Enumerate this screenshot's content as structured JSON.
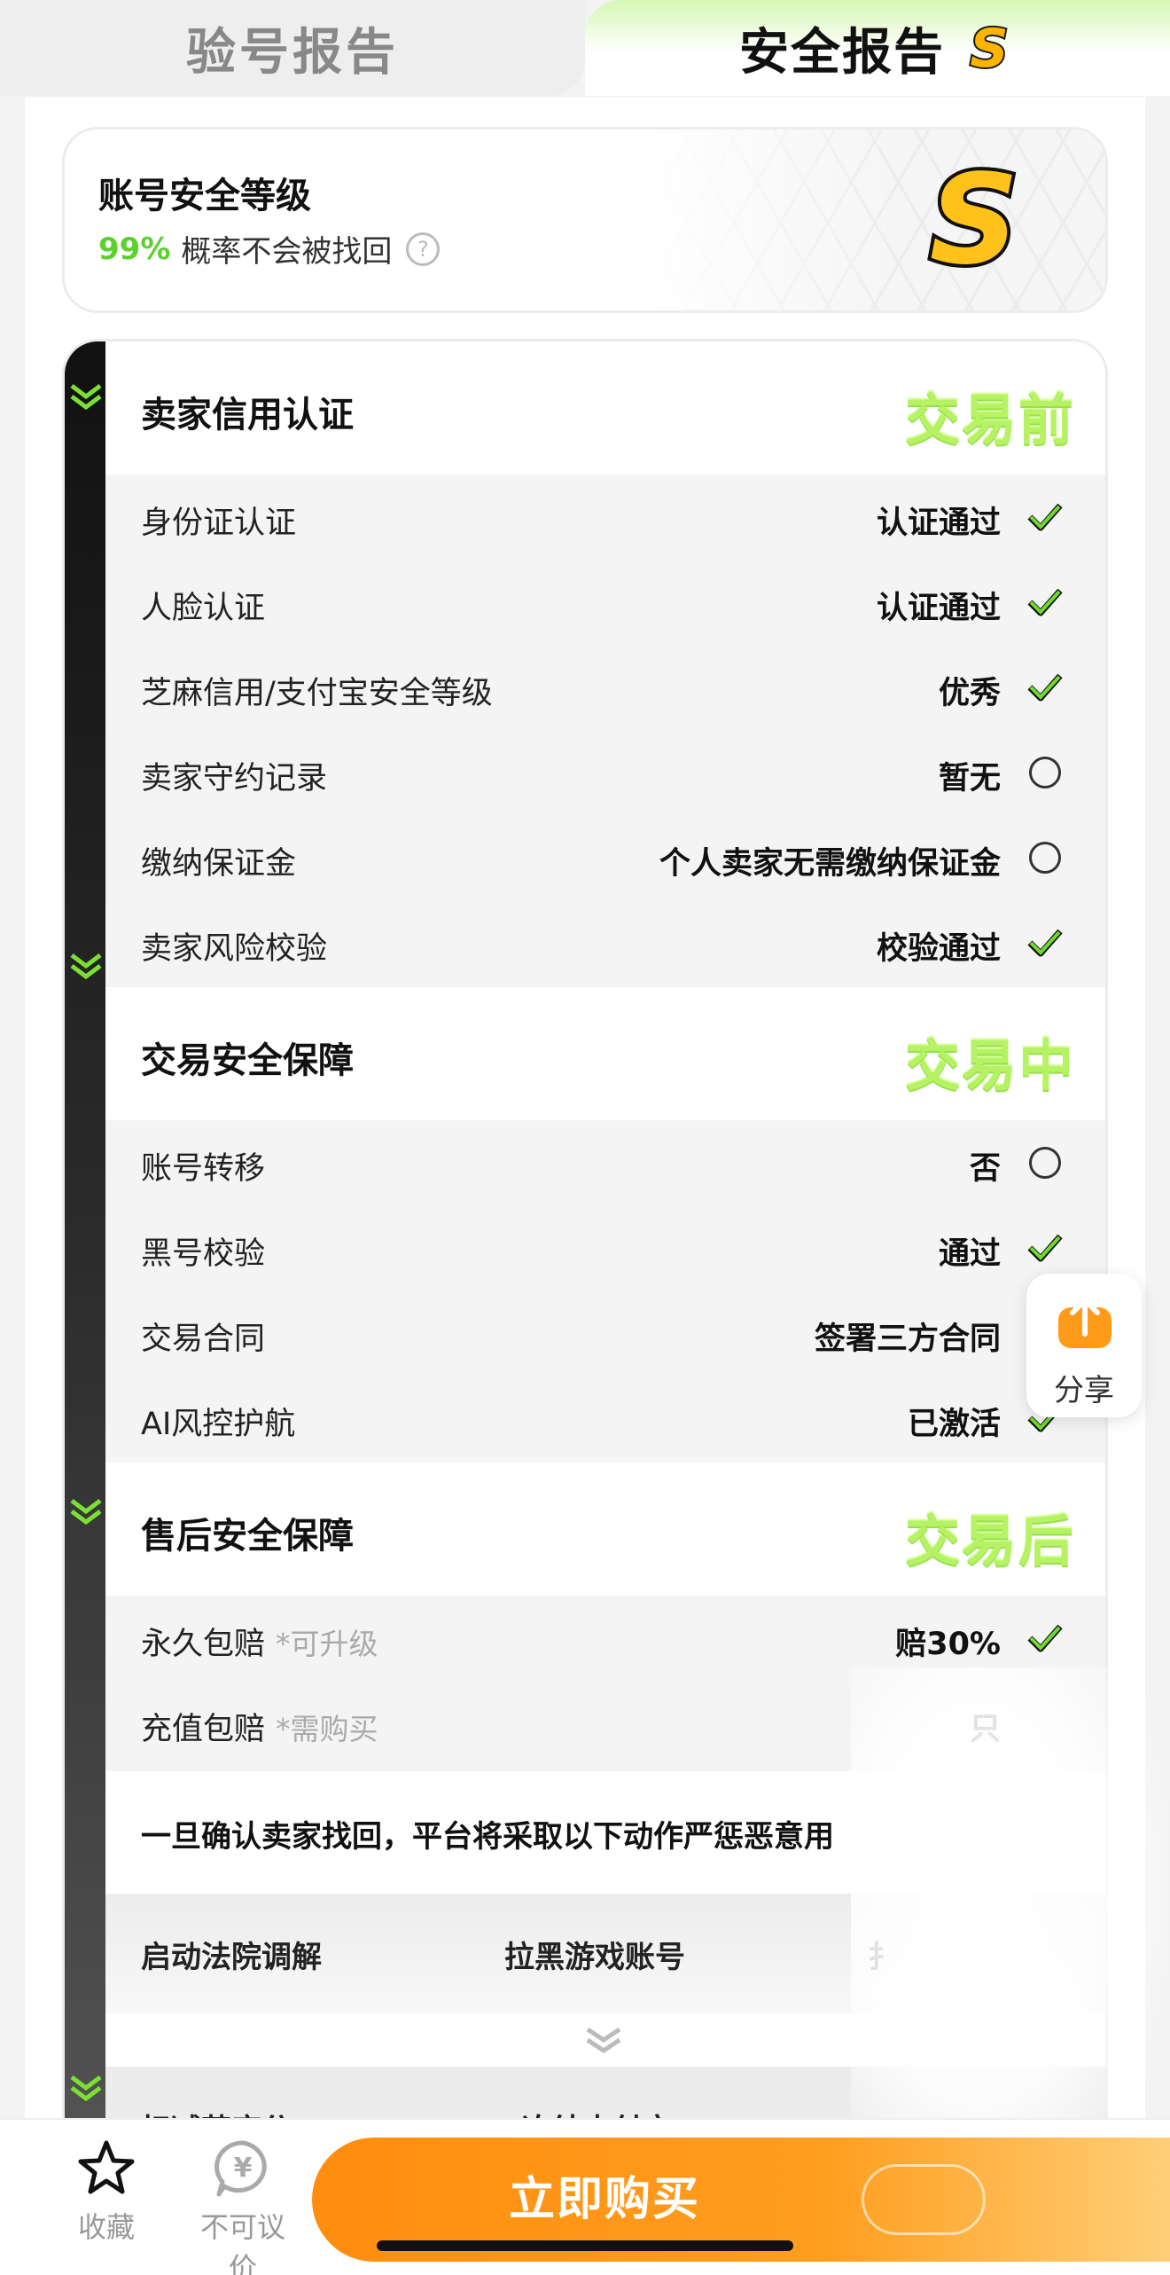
{
  "tabs": {
    "inspection_report": "验号报告",
    "security_report": "安全报告",
    "grade_letter": "S"
  },
  "security_level": {
    "title": "账号安全等级",
    "percent": "99%",
    "description": "概率不会被找回",
    "help_symbol": "?",
    "grade_letter": "S"
  },
  "sections": [
    {
      "title": "卖家信用认证",
      "stage": "交易前",
      "rows": [
        {
          "label": "身份证认证",
          "hint": "",
          "value": "认证通过",
          "status": "check"
        },
        {
          "label": "人脸认证",
          "hint": "",
          "value": "认证通过",
          "status": "check"
        },
        {
          "label": "芝麻信用/支付宝安全等级",
          "hint": "",
          "value": "优秀",
          "status": "check"
        },
        {
          "label": "卖家守约记录",
          "hint": "",
          "value": "暂无",
          "status": "circle"
        },
        {
          "label": "缴纳保证金",
          "hint": "",
          "value": "个人卖家无需缴纳保证金",
          "status": "circle"
        },
        {
          "label": "卖家风险校验",
          "hint": "",
          "value": "校验通过",
          "status": "check"
        }
      ]
    },
    {
      "title": "交易安全保障",
      "stage": "交易中",
      "rows": [
        {
          "label": "账号转移",
          "hint": "",
          "value": "否",
          "status": "circle"
        },
        {
          "label": "黑号校验",
          "hint": "",
          "value": "通过",
          "status": "check"
        },
        {
          "label": "交易合同",
          "hint": "",
          "value": "签署三方合同",
          "status": "check"
        },
        {
          "label": "AI风控护航",
          "hint": "",
          "value": "已激活",
          "status": "check"
        }
      ]
    },
    {
      "title": "售后安全保障",
      "stage": "交易后",
      "rows": [
        {
          "label": "永久包赔",
          "hint": "*可升级",
          "value": "赔30%",
          "status": "check"
        },
        {
          "label": "充值包赔",
          "hint": "*需购买",
          "value": "只",
          "status": "none"
        }
      ]
    }
  ],
  "notice": "一旦确认卖家找回，平台将采取以下动作严惩恶意用",
  "actions_row1": [
    "启动法院调解",
    "拉黑游戏账号",
    "扌"
  ],
  "actions_row2": [
    "扣减芝麻分",
    "冻结支付宝"
  ],
  "share": {
    "label": "分享",
    "icon": "share-upload-icon"
  },
  "bottom_bar": {
    "favorite": "收藏",
    "no_bargain": "不可议价",
    "no_bargain_symbol": "¥",
    "buy": "立即购买"
  },
  "colors": {
    "accent_orange": "#ff8d0e",
    "success_green": "#5bd12d",
    "stage_green": "#b6f264"
  }
}
